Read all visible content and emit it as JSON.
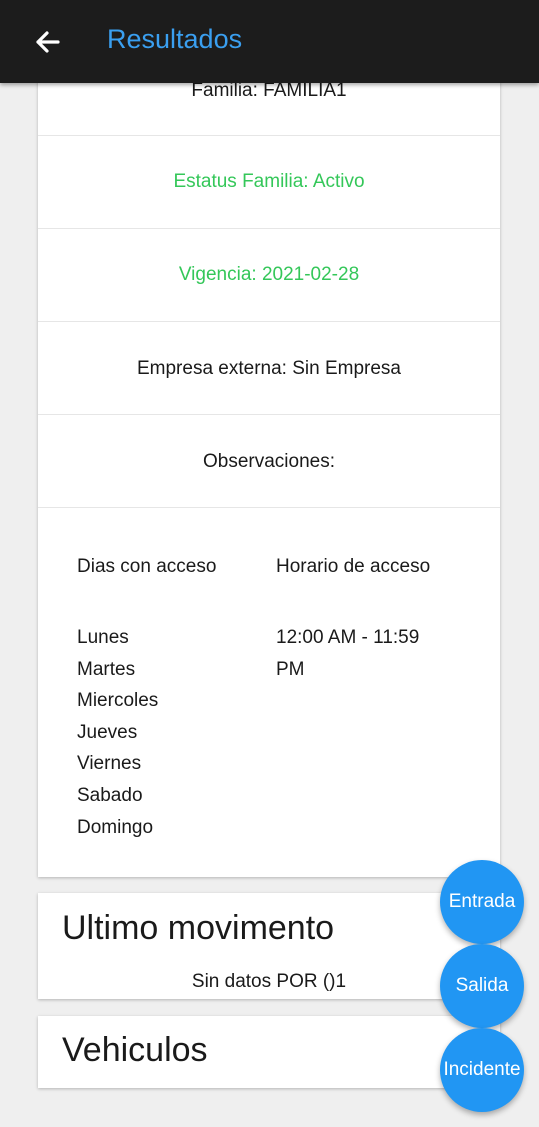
{
  "appbar": {
    "title": "Resultados",
    "back_icon": "arrow-left-icon"
  },
  "info": {
    "familia": "Familia: FAMILIA1",
    "estatus": "Estatus Familia: Activo",
    "vigencia": "Vigencia: 2021-02-28",
    "empresa": "Empresa externa: Sin Empresa",
    "observaciones": "Observaciones:",
    "status_color": "#34c759"
  },
  "access": {
    "days_header": "Dias con acceso",
    "hours_header": "Horario de acceso",
    "days": [
      "Lunes",
      "Martes",
      "Miercoles",
      "Jueves",
      "Viernes",
      "Sabado",
      "Domingo"
    ],
    "hours_line1": "12:00 AM - 11:59",
    "hours_line2": "PM"
  },
  "movimiento": {
    "title": "Ultimo movimento",
    "subtitle": "Sin datos POR ()1"
  },
  "vehiculos": {
    "title": "Vehiculos"
  },
  "fabs": {
    "entrada": "Entrada",
    "salida": "Salida",
    "incidente": "Incidente",
    "color": "#2196f3"
  },
  "accent": "#3a9ff0"
}
